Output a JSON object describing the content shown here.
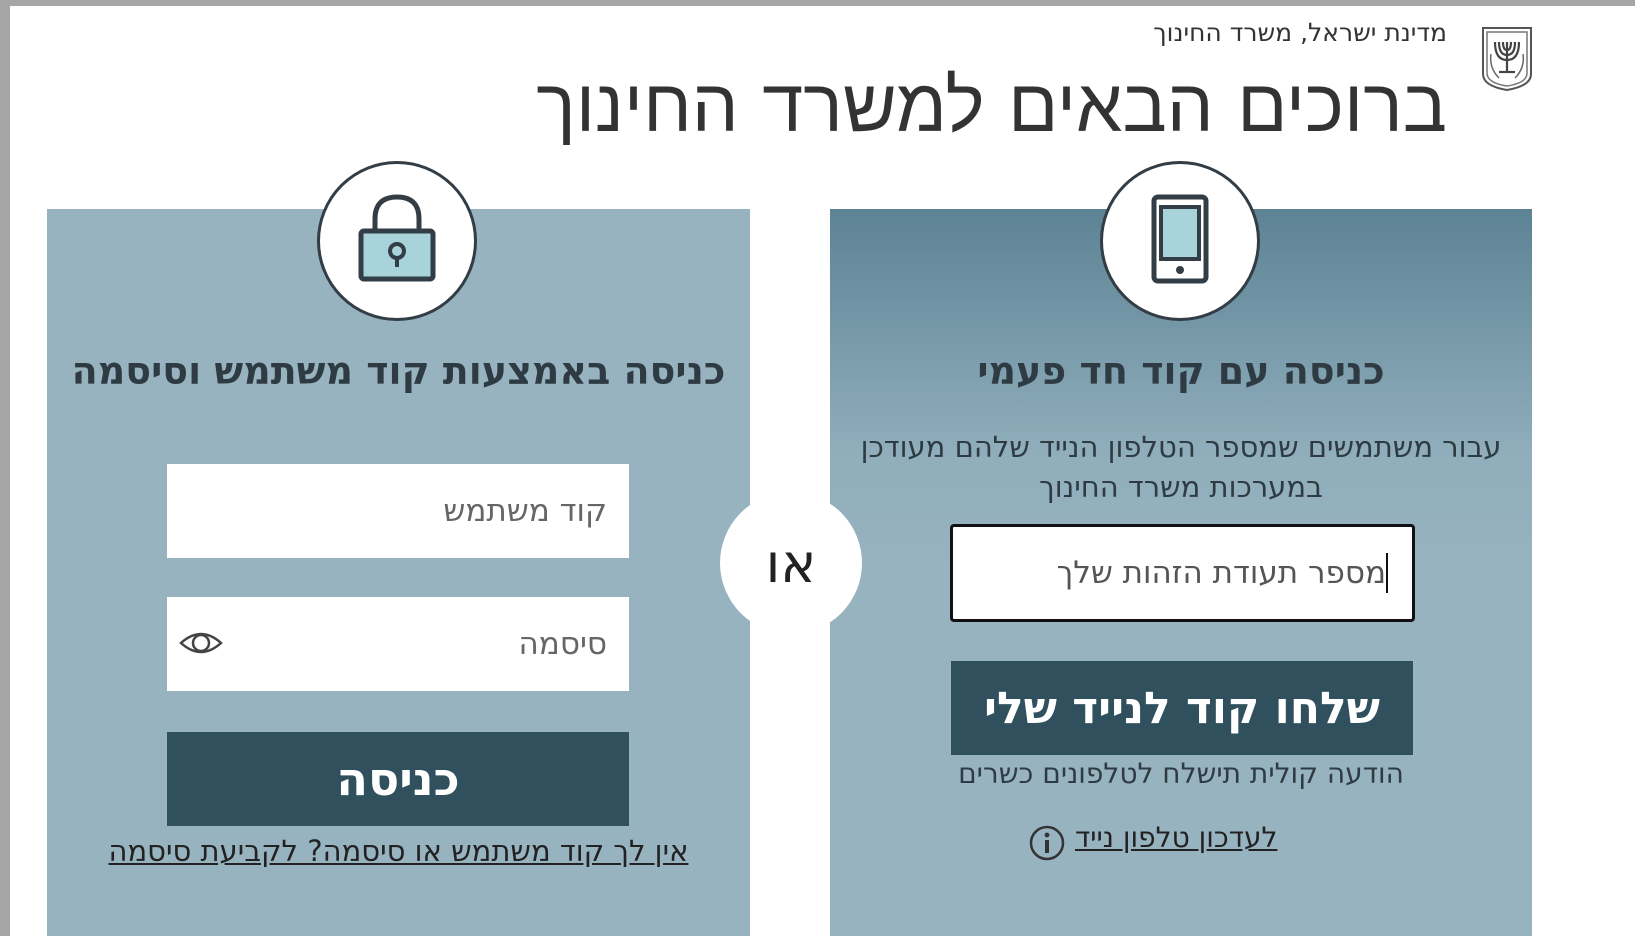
{
  "header": {
    "ministry_caption": "מדינת ישראל, משרד החינוך",
    "title": "ברוכים הבאים למשרד החינוך",
    "emblem_icon": "state-emblem-menorah-icon"
  },
  "divider": {
    "or_label": "או"
  },
  "password_login": {
    "icon": "padlock-icon",
    "title": "כניסה באמצעות קוד משתמש וסיסמה",
    "username_placeholder": "קוד משתמש",
    "password_placeholder": "סיסמה",
    "password_toggle_icon": "eye-icon",
    "submit_label": "כניסה",
    "forgot_link": "אין לך קוד משתמש או סיסמה? לקביעת סיסמה"
  },
  "otp_login": {
    "icon": "mobile-phone-icon",
    "title": "כניסה עם קוד חד פעמי",
    "description": "עבור משתמשים שמספר הטלפון הנייד שלהם מעודכן במערכות משרד החינוך",
    "id_placeholder": "מספר תעודת הזהות שלך",
    "send_code_label": "שלחו קוד לנייד שלי",
    "voice_note": "הודעה קולית תישלח לטלפונים כשרים",
    "update_phone_link": "לעדכון טלפון נייד",
    "info_icon": "info-icon"
  },
  "colors": {
    "panel_bg": "#98b3c0",
    "panel_top_gradient": "#5c8394",
    "button_bg": "#30505e",
    "text_dark": "#2e3b43"
  }
}
